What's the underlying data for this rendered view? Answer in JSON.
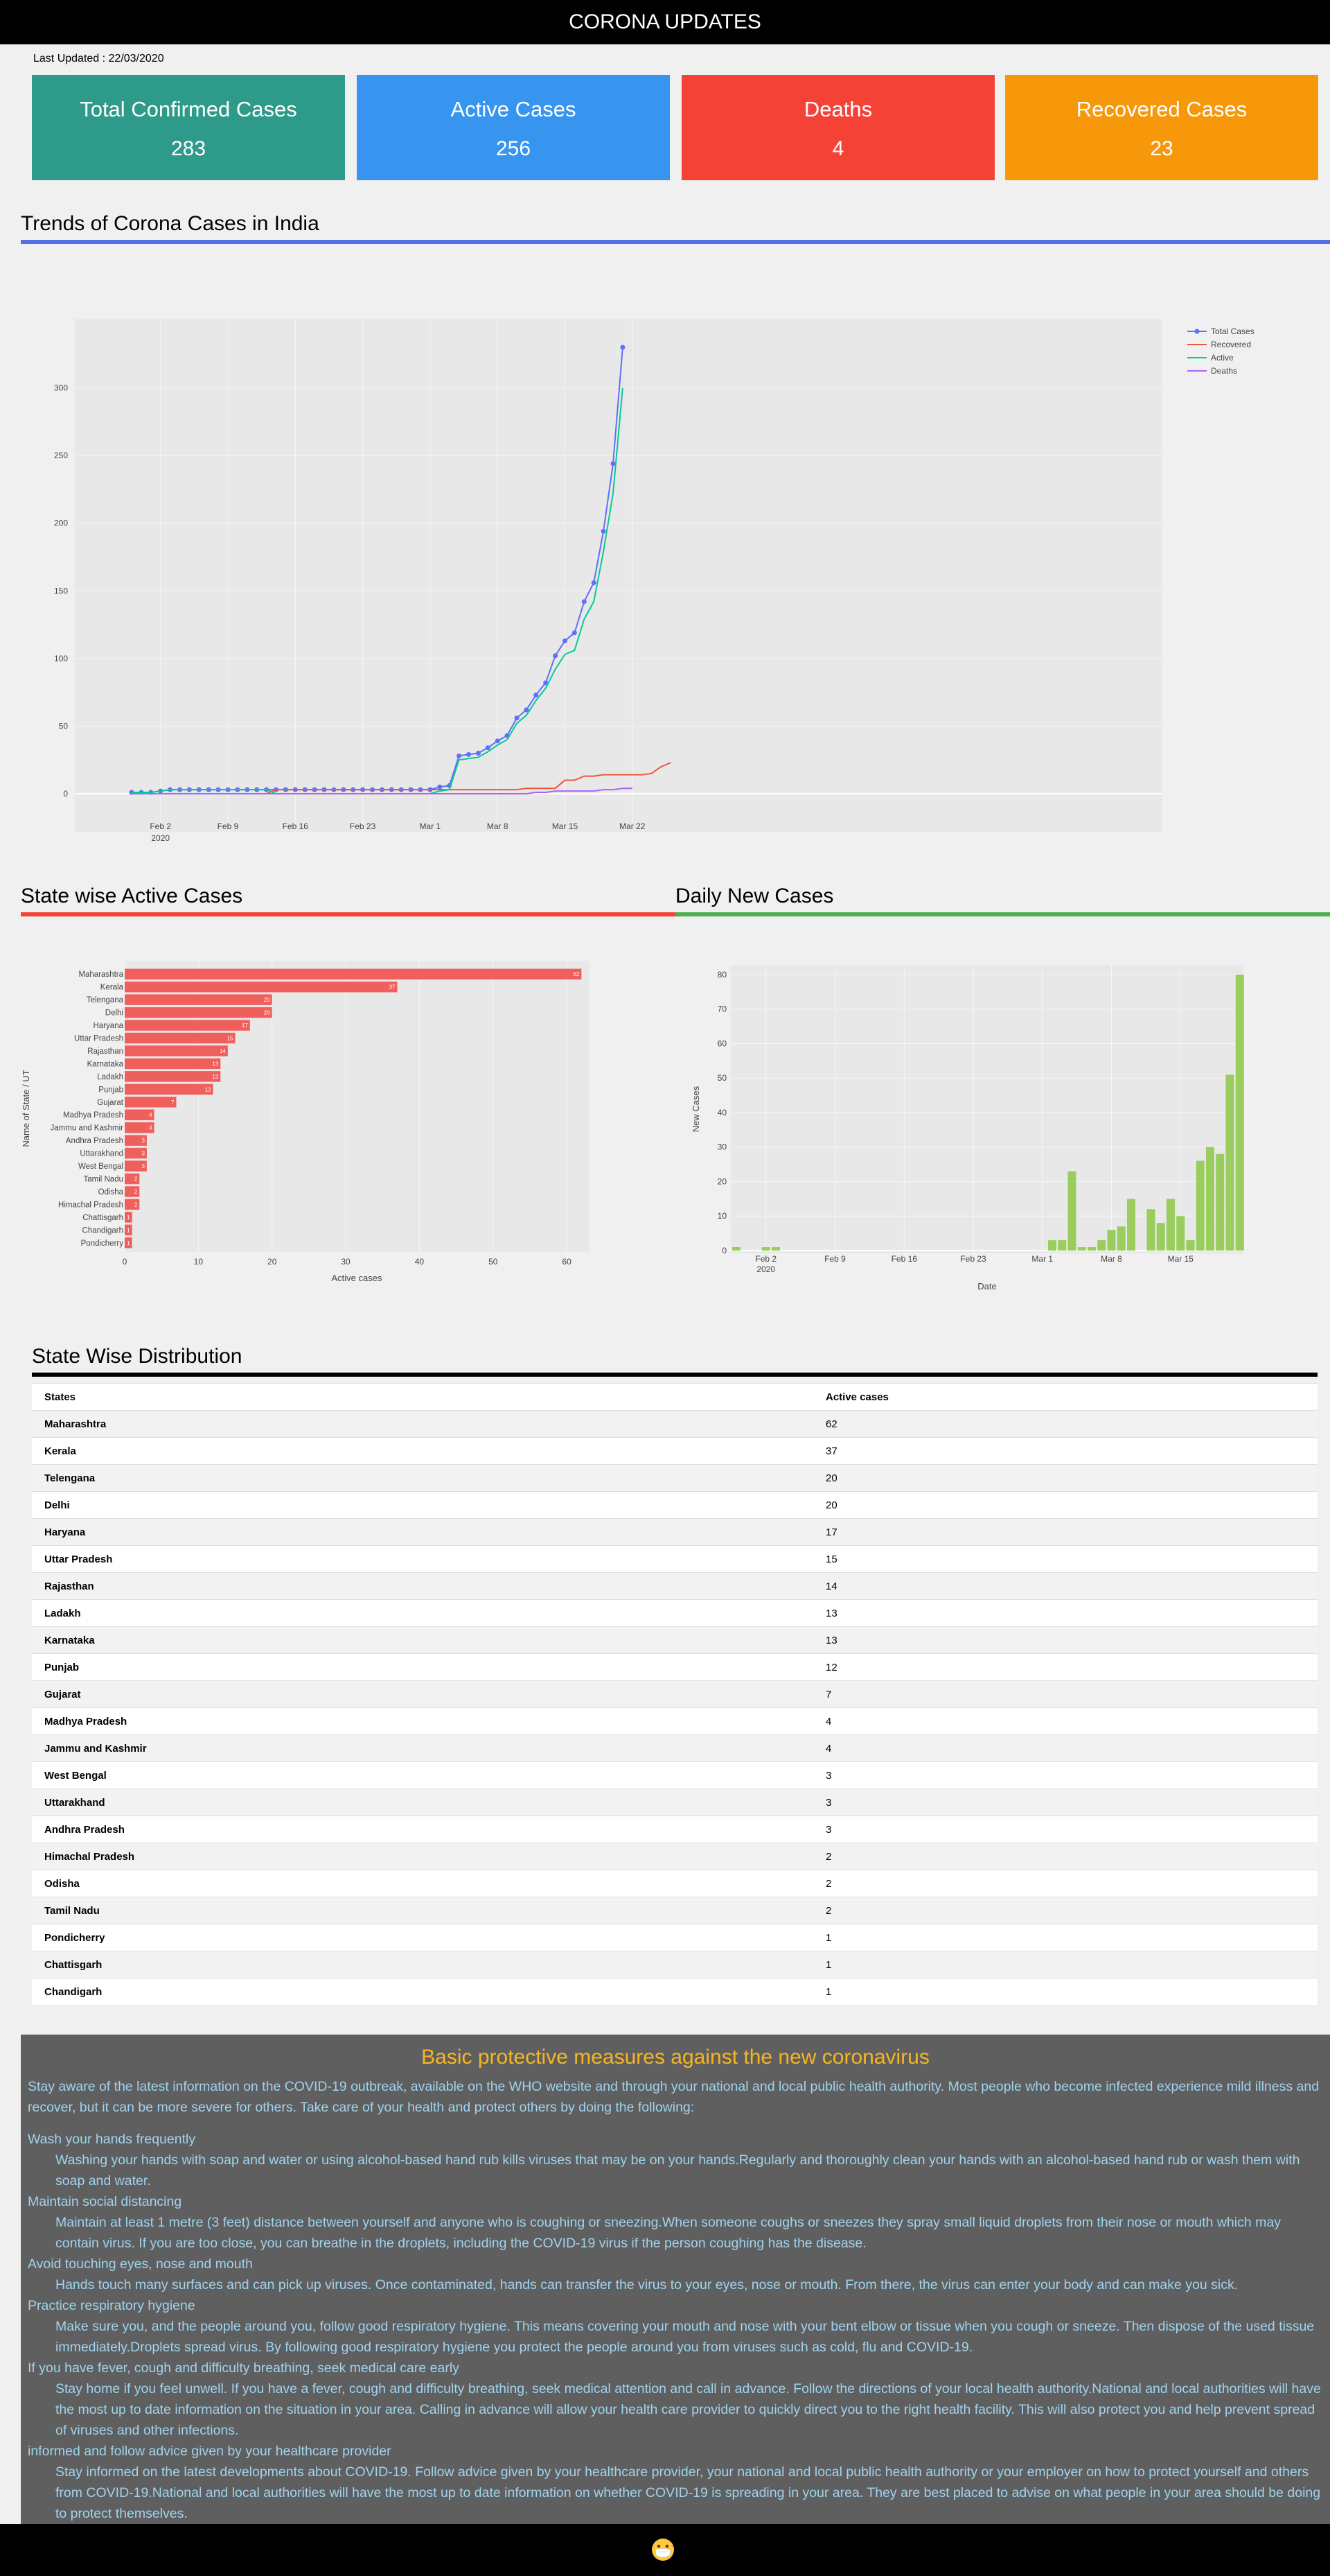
{
  "header": {
    "title": "CORONA UPDATES"
  },
  "last_updated": "Last Updated : 22/03/2020",
  "cards": [
    {
      "label": "Total Confirmed Cases",
      "value": "283",
      "color": "#2e9a8a"
    },
    {
      "label": "Active Cases",
      "value": "256",
      "color": "#3795f0"
    },
    {
      "label": "Deaths",
      "value": "4",
      "color": "#f44336"
    },
    {
      "label": "Recovered Cases",
      "value": "23",
      "color": "#f7980a"
    }
  ],
  "sections": {
    "trends": "Trends of Corona Cases in India",
    "state_active": "State wise Active Cases",
    "daily_new": "Daily New Cases",
    "distribution": "State Wise Distribution"
  },
  "chart_data": [
    {
      "type": "line",
      "x_start": "2020-01-30",
      "x_end": "2020-03-21",
      "xticks": [
        "Feb 2",
        "Feb 9",
        "Feb 16",
        "Feb 23",
        "Mar 1",
        "Mar 8",
        "Mar 15",
        "Mar 22"
      ],
      "xtick_sub": "2020",
      "ylim": [
        0,
        330
      ],
      "yticks": [
        0,
        50,
        100,
        150,
        200,
        250,
        300
      ],
      "legend_position": "top-right",
      "series": [
        {
          "name": "Total Cases",
          "color": "#636efa",
          "markers": true,
          "values": [
            1,
            1,
            1,
            2,
            3,
            3,
            3,
            3,
            3,
            3,
            3,
            3,
            3,
            3,
            3,
            3,
            3,
            3,
            3,
            3,
            3,
            3,
            3,
            3,
            3,
            3,
            3,
            3,
            3,
            3,
            3,
            3,
            5,
            6,
            28,
            29,
            30,
            34,
            39,
            43,
            56,
            62,
            73,
            82,
            102,
            113,
            119,
            142,
            156,
            194,
            244,
            330
          ]
        },
        {
          "name": "Recovered",
          "color": "#ef553b",
          "markers": false,
          "values": [
            0,
            0,
            0,
            0,
            0,
            0,
            0,
            0,
            0,
            0,
            0,
            0,
            0,
            0,
            0,
            3,
            3,
            3,
            3,
            3,
            3,
            3,
            3,
            3,
            3,
            3,
            3,
            3,
            3,
            3,
            3,
            3,
            3,
            3,
            3,
            3,
            3,
            3,
            3,
            3,
            3,
            4,
            4,
            4,
            4,
            10,
            10,
            13,
            13,
            14,
            14,
            14,
            14,
            14,
            15,
            20,
            23
          ]
        },
        {
          "name": "Active",
          "color": "#00cc96",
          "markers": false,
          "values": [
            1,
            1,
            1,
            2,
            3,
            3,
            3,
            3,
            3,
            3,
            3,
            3,
            3,
            3,
            3,
            0,
            0,
            0,
            0,
            0,
            0,
            0,
            0,
            0,
            0,
            0,
            0,
            0,
            0,
            0,
            0,
            0,
            2,
            3,
            25,
            26,
            27,
            31,
            36,
            40,
            52,
            58,
            69,
            78,
            92,
            103,
            106,
            129,
            142,
            179,
            222,
            300
          ]
        },
        {
          "name": "Deaths",
          "color": "#ab63fa",
          "markers": false,
          "values": [
            0,
            0,
            0,
            0,
            0,
            0,
            0,
            0,
            0,
            0,
            0,
            0,
            0,
            0,
            0,
            0,
            0,
            0,
            0,
            0,
            0,
            0,
            0,
            0,
            0,
            0,
            0,
            0,
            0,
            0,
            0,
            0,
            0,
            0,
            0,
            0,
            0,
            0,
            0,
            0,
            0,
            0,
            1,
            1,
            2,
            2,
            2,
            2,
            2,
            3,
            3,
            4,
            4
          ]
        }
      ]
    },
    {
      "type": "bar",
      "orientation": "horizontal",
      "color": "#ef5f5b",
      "xlabel": "Active cases",
      "ylabel": "Name of State / UT",
      "xlim": [
        0,
        63
      ],
      "xticks": [
        0,
        10,
        20,
        30,
        40,
        50,
        60
      ],
      "categories": [
        "Maharashtra",
        "Kerala",
        "Telengana",
        "Delhi",
        "Haryana",
        "Uttar Pradesh",
        "Rajasthan",
        "Karnataka",
        "Ladakh",
        "Punjab",
        "Gujarat",
        "Madhya Pradesh",
        "Jammu and Kashmir",
        "Andhra Pradesh",
        "Uttarakhand",
        "West Bengal",
        "Tamil Nadu",
        "Odisha",
        "Himachal Pradesh",
        "Chattisgarh",
        "Chandigarh",
        "Pondicherry"
      ],
      "values": [
        62,
        37,
        20,
        20,
        17,
        15,
        14,
        13,
        13,
        12,
        7,
        4,
        4,
        3,
        3,
        3,
        2,
        2,
        2,
        1,
        1,
        1
      ]
    },
    {
      "type": "bar",
      "color": "#9acd5e",
      "xlabel": "Date",
      "ylabel": "New Cases",
      "ylim": [
        0,
        82
      ],
      "yticks": [
        0,
        10,
        20,
        30,
        40,
        50,
        60,
        70,
        80
      ],
      "xticks": [
        "Feb 2",
        "Feb 9",
        "Feb 16",
        "Feb 23",
        "Mar 1",
        "Mar 8",
        "Mar 15"
      ],
      "xtick_sub": "2020",
      "x_start": "2020-01-30",
      "x_end": "2020-03-21",
      "values": [
        1,
        0,
        0,
        1,
        1,
        0,
        0,
        0,
        0,
        0,
        0,
        0,
        0,
        0,
        0,
        0,
        0,
        0,
        0,
        0,
        0,
        0,
        0,
        0,
        0,
        0,
        0,
        0,
        0,
        0,
        0,
        0,
        3,
        3,
        23,
        1,
        1,
        3,
        6,
        7,
        15,
        0,
        12,
        8,
        15,
        10,
        3,
        26,
        30,
        28,
        51,
        80
      ]
    }
  ],
  "table": {
    "headers": [
      "States",
      "Active cases"
    ],
    "rows": [
      [
        "Maharashtra",
        "62"
      ],
      [
        "Kerala",
        "37"
      ],
      [
        "Telengana",
        "20"
      ],
      [
        "Delhi",
        "20"
      ],
      [
        "Haryana",
        "17"
      ],
      [
        "Uttar Pradesh",
        "15"
      ],
      [
        "Rajasthan",
        "14"
      ],
      [
        "Ladakh",
        "13"
      ],
      [
        "Karnataka",
        "13"
      ],
      [
        "Punjab",
        "12"
      ],
      [
        "Gujarat",
        "7"
      ],
      [
        "Madhya Pradesh",
        "4"
      ],
      [
        "Jammu and Kashmir",
        "4"
      ],
      [
        "West Bengal",
        "3"
      ],
      [
        "Uttarakhand",
        "3"
      ],
      [
        "Andhra Pradesh",
        "3"
      ],
      [
        "Himachal Pradesh",
        "2"
      ],
      [
        "Odisha",
        "2"
      ],
      [
        "Tamil Nadu",
        "2"
      ],
      [
        "Pondicherry",
        "1"
      ],
      [
        "Chattisgarh",
        "1"
      ],
      [
        "Chandigarh",
        "1"
      ]
    ]
  },
  "advice": {
    "title": "Basic protective measures against the new coronavirus",
    "intro": "Stay aware of the latest information on the COVID-19 outbreak, available on the WHO website and through your national and local public health authority. Most people who become infected experience mild illness and recover, but it can be more severe for others. Take care of your health and protect others by doing the following:",
    "items": [
      {
        "heading": "Wash your hands frequently",
        "text": "Washing your hands with soap and water or using alcohol-based hand rub kills viruses that may be on your hands.Regularly and thoroughly clean your hands with an alcohol-based hand rub or wash them with soap and water."
      },
      {
        "heading": "Maintain social distancing",
        "text": "Maintain at least 1 metre (3 feet) distance between yourself and anyone who is coughing or sneezing.When someone coughs or sneezes they spray small liquid droplets from their nose or mouth which may contain virus. If you are too close, you can breathe in the droplets, including the COVID-19 virus if the person coughing has the disease."
      },
      {
        "heading": "Avoid touching eyes, nose and mouth",
        "text": "Hands touch many surfaces and can pick up viruses. Once contaminated, hands can transfer the virus to your eyes, nose or mouth. From there, the virus can enter your body and can make you sick."
      },
      {
        "heading": "Practice respiratory hygiene",
        "text": "Make sure you, and the people around you, follow good respiratory hygiene. This means covering your mouth and nose with your bent elbow or tissue when you cough or sneeze. Then dispose of the used tissue immediately.Droplets spread virus. By following good respiratory hygiene you protect the people around you from viruses such as cold, flu and COVID-19."
      },
      {
        "heading": "If you have fever, cough and difficulty breathing, seek medical care early",
        "text": "Stay home if you feel unwell. If you have a fever, cough and difficulty breathing, seek medical attention and call in advance. Follow the directions of your local health authority.National and local authorities will have the most up to date information on the situation in your area. Calling in advance will allow your health care provider to quickly direct you to the right health facility. This will also protect you and help prevent spread of viruses and other infections."
      },
      {
        "heading": "informed and follow advice given by your healthcare provider",
        "text": "Stay informed on the latest developments about COVID-19. Follow advice given by your healthcare provider, your national and local public health authority or your employer on how to protect yourself and others from COVID-19.National and local authorities will have the most up to date information on whether COVID-19 is spreading in your area. They are best placed to advise on what people in your area should be doing to protect themselves."
      }
    ]
  },
  "footer": {
    "icon": "face-mask-icon"
  }
}
